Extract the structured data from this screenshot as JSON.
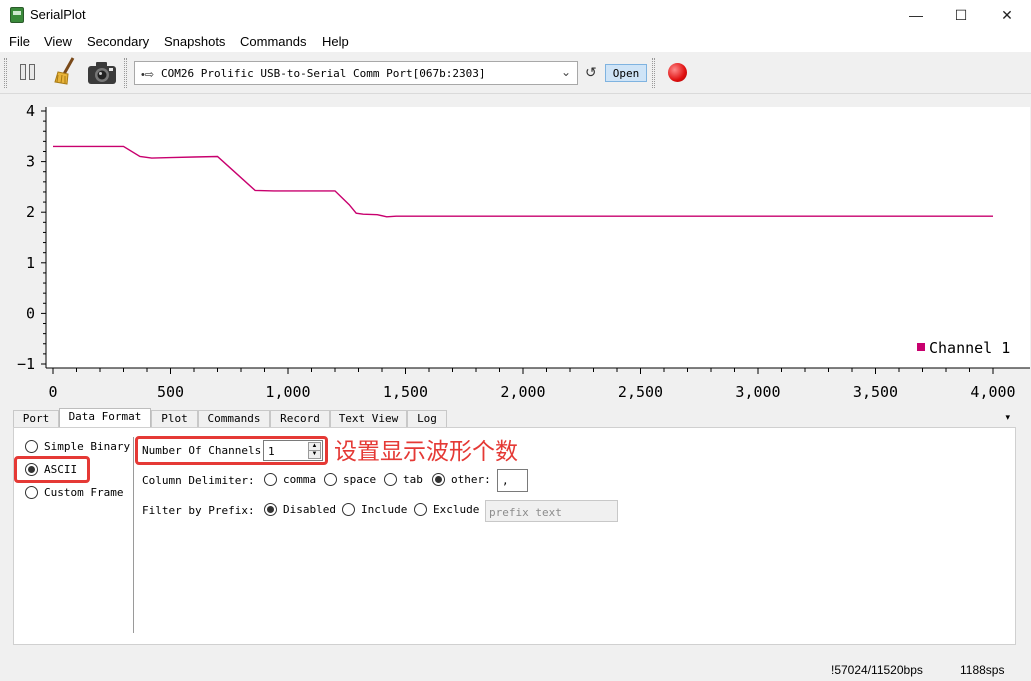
{
  "window": {
    "title": "SerialPlot"
  },
  "menu": [
    "File",
    "View",
    "Secondary",
    "Snapshots",
    "Commands",
    "Help"
  ],
  "toolbar": {
    "pause_icon": "pause-icon",
    "clear_icon": "broom-icon",
    "snapshot_icon": "camera-icon",
    "port_selected": "COM26 Prolific USB-to-Serial Comm Port[067b:2303]",
    "open_label": "Open",
    "record_color": "#e01010"
  },
  "plot": {
    "y_ticks": [
      "4",
      "3",
      "2",
      "1",
      "0",
      "−1"
    ],
    "x_ticks": [
      "0",
      "500",
      "1,000",
      "1,500",
      "2,000",
      "2,500",
      "3,000",
      "3,500",
      "4,000"
    ],
    "legend": "Channel 1",
    "line_color": "#c8006e"
  },
  "chart_data": {
    "type": "line",
    "xlim": [
      0,
      4000
    ],
    "ylim": [
      -1,
      4
    ],
    "grid": false,
    "legend_position": "bottom-right",
    "series": [
      {
        "name": "Channel 1",
        "x": [
          0,
          300,
          370,
          420,
          500,
          600,
          700,
          760,
          860,
          940,
          1000,
          1100,
          1200,
          1260,
          1290,
          1320,
          1380,
          1420,
          1460,
          1500,
          2000,
          2500,
          3000,
          3500,
          4000
        ],
        "y": [
          3.3,
          3.3,
          3.1,
          3.07,
          3.08,
          3.09,
          3.1,
          2.85,
          2.43,
          2.42,
          2.42,
          2.42,
          2.42,
          2.15,
          1.98,
          1.96,
          1.95,
          1.91,
          1.92,
          1.92,
          1.92,
          1.92,
          1.92,
          1.92,
          1.92
        ]
      }
    ]
  },
  "tabs": [
    "Port",
    "Data Format",
    "Plot",
    "Commands",
    "Record",
    "Text View",
    "Log"
  ],
  "active_tab": "Data Format",
  "tab_overflow": "▾",
  "data_format": {
    "format_options": [
      "Simple Binary",
      "ASCII",
      "Custom Frame"
    ],
    "selected_format": "ASCII",
    "channels_label": "Number Of Channels:",
    "channels_value": "1",
    "delimiter_label": "Column Delimiter:",
    "delimiter_options": [
      "comma",
      "space",
      "tab",
      "other:"
    ],
    "delimiter_selected": "other:",
    "delimiter_value": ",",
    "prefix_label": "Filter by Prefix:",
    "prefix_options": [
      "Disabled",
      "Include",
      "Exclude"
    ],
    "prefix_selected": "Disabled",
    "prefix_placeholder": "prefix text"
  },
  "annotation": {
    "text": "设置显示波形个数",
    "color": "#e53935"
  },
  "status": {
    "bps": "!57024/11520bps",
    "sps": "1188sps"
  }
}
